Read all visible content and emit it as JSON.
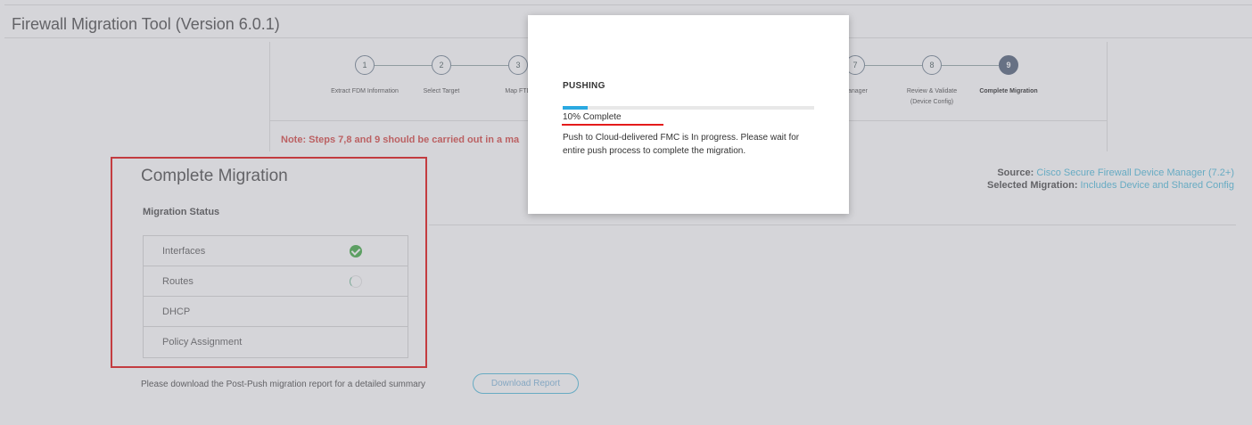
{
  "app": {
    "title": "Firewall Migration Tool (Version 6.0.1)"
  },
  "stepper": {
    "steps": [
      {
        "number": "1",
        "label": "Extract FDM Information",
        "label2": ""
      },
      {
        "number": "2",
        "label": "Select Target",
        "label2": ""
      },
      {
        "number": "3",
        "label": "Map FTD",
        "label2": ""
      },
      {
        "number": "7",
        "label": "Manager",
        "label2": ""
      },
      {
        "number": "8",
        "label": "Review & Validate",
        "label2": "(Device Config)"
      },
      {
        "number": "9",
        "label": "Complete Migration",
        "label2": "",
        "active": true
      }
    ],
    "note": "Note: Steps 7,8 and 9 should be carried out in a ma"
  },
  "section": {
    "title": "Complete Migration",
    "status_label": "Migration Status",
    "rows": [
      {
        "name": "Interfaces",
        "status": "complete"
      },
      {
        "name": "Routes",
        "status": "in-progress"
      },
      {
        "name": "DHCP",
        "status": ""
      },
      {
        "name": "Policy Assignment",
        "status": ""
      }
    ]
  },
  "source": {
    "source_key": "Source:",
    "source_value": "Cisco Secure Firewall Device Manager (7.2+)",
    "migration_key": "Selected Migration:",
    "migration_value": "Includes Device and Shared Config"
  },
  "download": {
    "text": "Please download the Post-Push migration report for a detailed summary",
    "button_label": "Download Report"
  },
  "modal": {
    "title": "PUSHING",
    "progress_percent": 10,
    "progress_text": "10% Complete",
    "message": "Push to Cloud-delivered FMC is In progress. Please wait for entire push process to complete the migration."
  },
  "colors": {
    "accent": "#5bc0de",
    "progress": "#2ba9e1",
    "note": "#d9534f",
    "highlight": "#e41b1b",
    "success": "#4caf50"
  }
}
